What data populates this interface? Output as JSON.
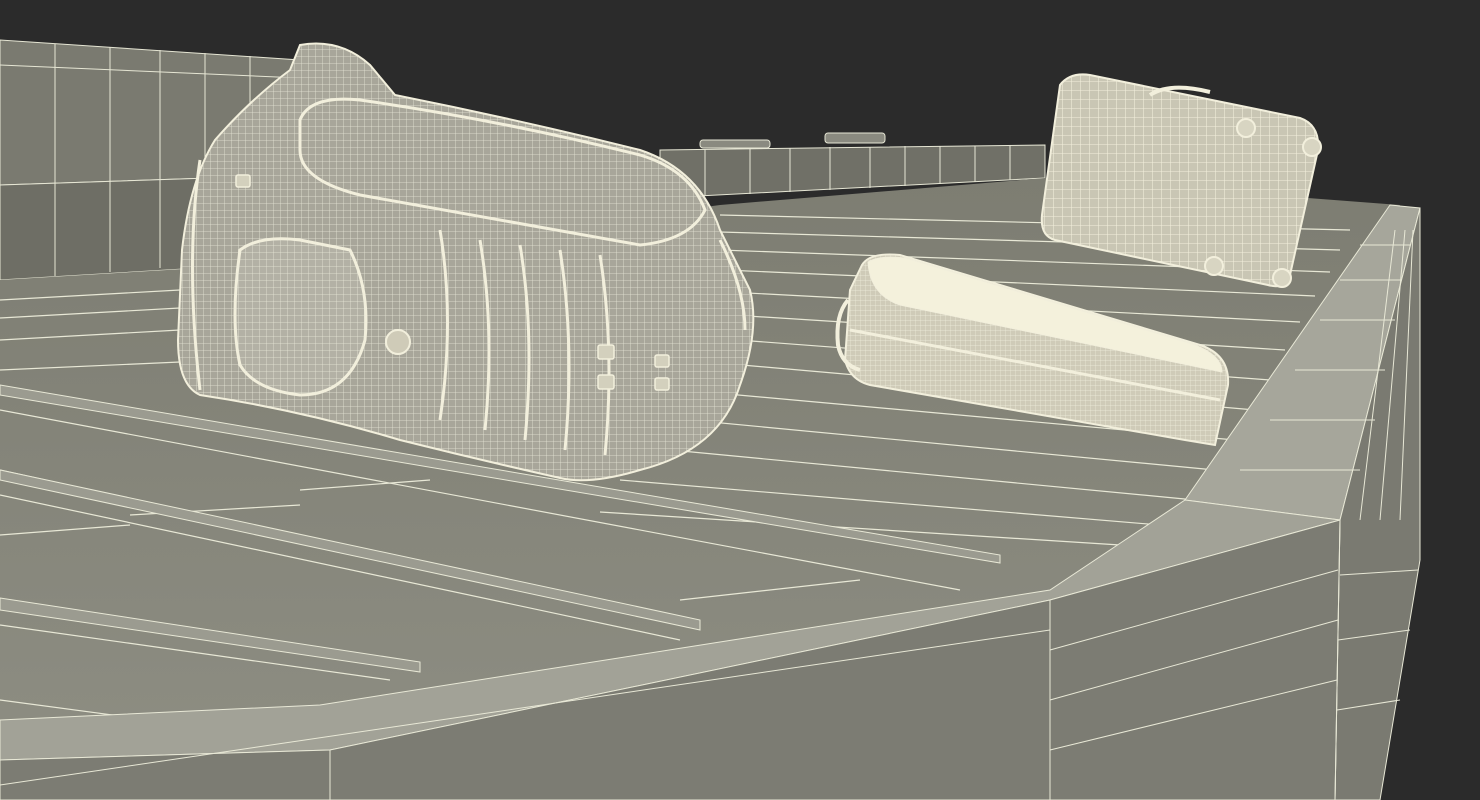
{
  "scene": {
    "subject": "baggage-carousel-wireframe-render",
    "colors": {
      "background": "#2b2b2b",
      "surface": "#8a8a7f",
      "surface_dark": "#6f6f66",
      "surface_light": "#a3a398",
      "wire": "#e9e9d8",
      "bag_cream": "#f4f1dc"
    },
    "objects": [
      "carousel-outer-wall",
      "conveyor-plates",
      "backpack",
      "suitcase-lying",
      "suitcase-upright",
      "distant-carousel-rail"
    ]
  }
}
